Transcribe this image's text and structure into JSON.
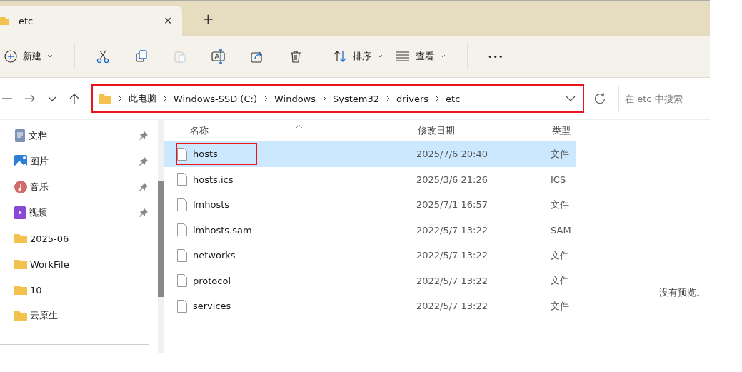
{
  "tab": {
    "title": "etc",
    "close": "✕",
    "new_tab": "+"
  },
  "toolbar": {
    "new": "新建",
    "sort": "排序",
    "view": "查看",
    "more": "•••"
  },
  "address_bar": {
    "highlighted": true,
    "path": [
      "此电脑",
      "Windows-SSD (C:)",
      "Windows",
      "System32",
      "drivers",
      "etc"
    ]
  },
  "search": {
    "placeholder": "在 etc 中搜索"
  },
  "sidebar": {
    "items": [
      {
        "kind": "documents",
        "label": "文档",
        "pinned": true
      },
      {
        "kind": "pictures",
        "label": "图片",
        "pinned": true
      },
      {
        "kind": "music",
        "label": "音乐",
        "pinned": true
      },
      {
        "kind": "videos",
        "label": "视频",
        "pinned": true
      },
      {
        "kind": "folder",
        "label": "2025-06",
        "pinned": false
      },
      {
        "kind": "folder",
        "label": "WorkFile",
        "pinned": false
      },
      {
        "kind": "folder",
        "label": "10",
        "pinned": false
      },
      {
        "kind": "folder",
        "label": "云原生",
        "pinned": false
      }
    ]
  },
  "table": {
    "columns": [
      "名称",
      "修改日期",
      "类型"
    ],
    "rows": [
      {
        "name": "hosts",
        "modified": "2025/7/6 20:40",
        "type": "文件",
        "selected": true,
        "highlighted": true
      },
      {
        "name": "hosts.ics",
        "modified": "2025/3/6 21:26",
        "type": "ICS",
        "selected": false,
        "highlighted": false
      },
      {
        "name": "lmhosts",
        "modified": "2025/7/1 16:57",
        "type": "文件",
        "selected": false,
        "highlighted": false
      },
      {
        "name": "lmhosts.sam",
        "modified": "2022/5/7 13:22",
        "type": "SAM",
        "selected": false,
        "highlighted": false
      },
      {
        "name": "networks",
        "modified": "2022/5/7 13:22",
        "type": "文件",
        "selected": false,
        "highlighted": false
      },
      {
        "name": "protocol",
        "modified": "2022/5/7 13:22",
        "type": "文件",
        "selected": false,
        "highlighted": false
      },
      {
        "name": "services",
        "modified": "2022/5/7 13:22",
        "type": "文件",
        "selected": false,
        "highlighted": false
      }
    ]
  },
  "preview": {
    "message": "没有预览。"
  }
}
